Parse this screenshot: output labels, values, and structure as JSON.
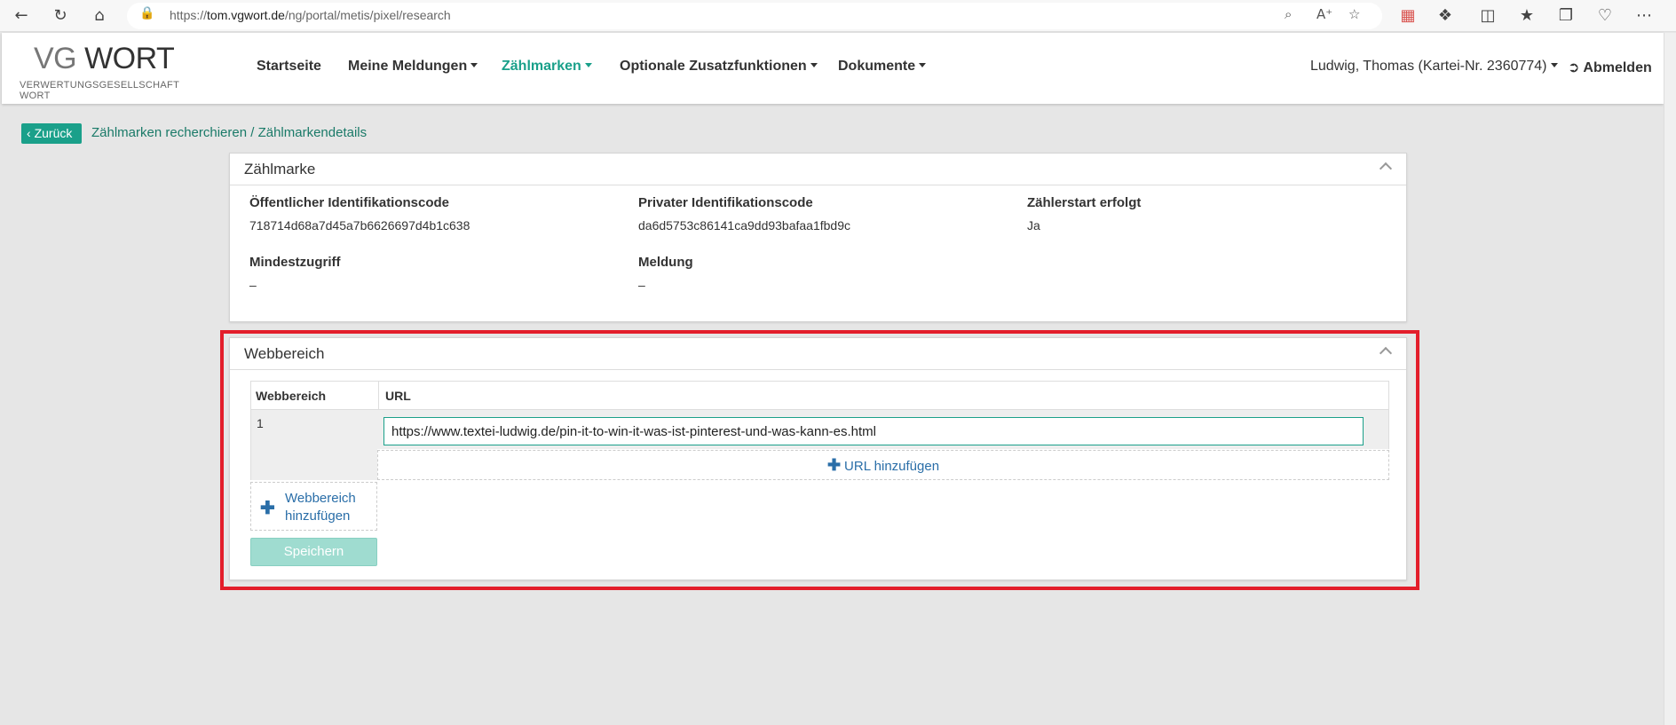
{
  "browser": {
    "url_prefix": "https://",
    "url_host": "tom.vgwort.de",
    "url_path": "/ng/portal/metis/pixel/research",
    "icons": [
      "back-icon",
      "refresh-icon",
      "home-icon",
      "lock-icon",
      "zoom-icon",
      "read-aloud-icon",
      "favorite-icon",
      "extension-icon",
      "split-screen-icon",
      "favorites-icon",
      "collections-icon",
      "health-icon",
      "more-icon"
    ]
  },
  "header": {
    "logo_vg": "VG",
    "logo_wort": "WORT",
    "logo_sub": "VERWERTUNGSGESELLSCHAFT WORT",
    "nav": [
      {
        "label": "Startseite",
        "dropdown": false
      },
      {
        "label": "Meine Meldungen",
        "dropdown": true
      },
      {
        "label": "Zählmarken",
        "dropdown": true,
        "active": true
      },
      {
        "label": "Optionale Zusatzfunktionen",
        "dropdown": true
      },
      {
        "label": "Dokumente",
        "dropdown": true
      }
    ],
    "user": "Ludwig, Thomas (Kartei-Nr. 2360774)",
    "logout": "Abmelden",
    "accent_color": "#1aa08a"
  },
  "breadcrumb": {
    "back_label": "Zurück",
    "path": "Zählmarken recherchieren / Zählmarkendetails"
  },
  "zaehlmarke": {
    "title": "Zählmarke",
    "fields": {
      "public_label": "Öffentlicher Identifikationscode",
      "public_value": "718714d68a7d45a7b6626697d4b1c638",
      "private_label": "Privater Identifikationscode",
      "private_value": "da6d5753c86141ca9dd93bafaa1fbd9c",
      "start_label": "Zählerstart erfolgt",
      "start_value": "Ja",
      "min_label": "Mindestzugriff",
      "min_value": "–",
      "meldung_label": "Meldung",
      "meldung_value": "–"
    }
  },
  "webbereich": {
    "title": "Webbereich",
    "col_webbereich": "Webbereich",
    "col_url": "URL",
    "rows": [
      {
        "number": "1",
        "url": "https://www.textei-ludwig.de/pin-it-to-win-it-was-ist-pinterest-und-was-kann-es.html"
      }
    ],
    "add_url_label": "URL hinzufügen",
    "add_webbereich_line1": "Webbereich",
    "add_webbereich_line2": "hinzufügen",
    "save_label": "Speichern"
  }
}
